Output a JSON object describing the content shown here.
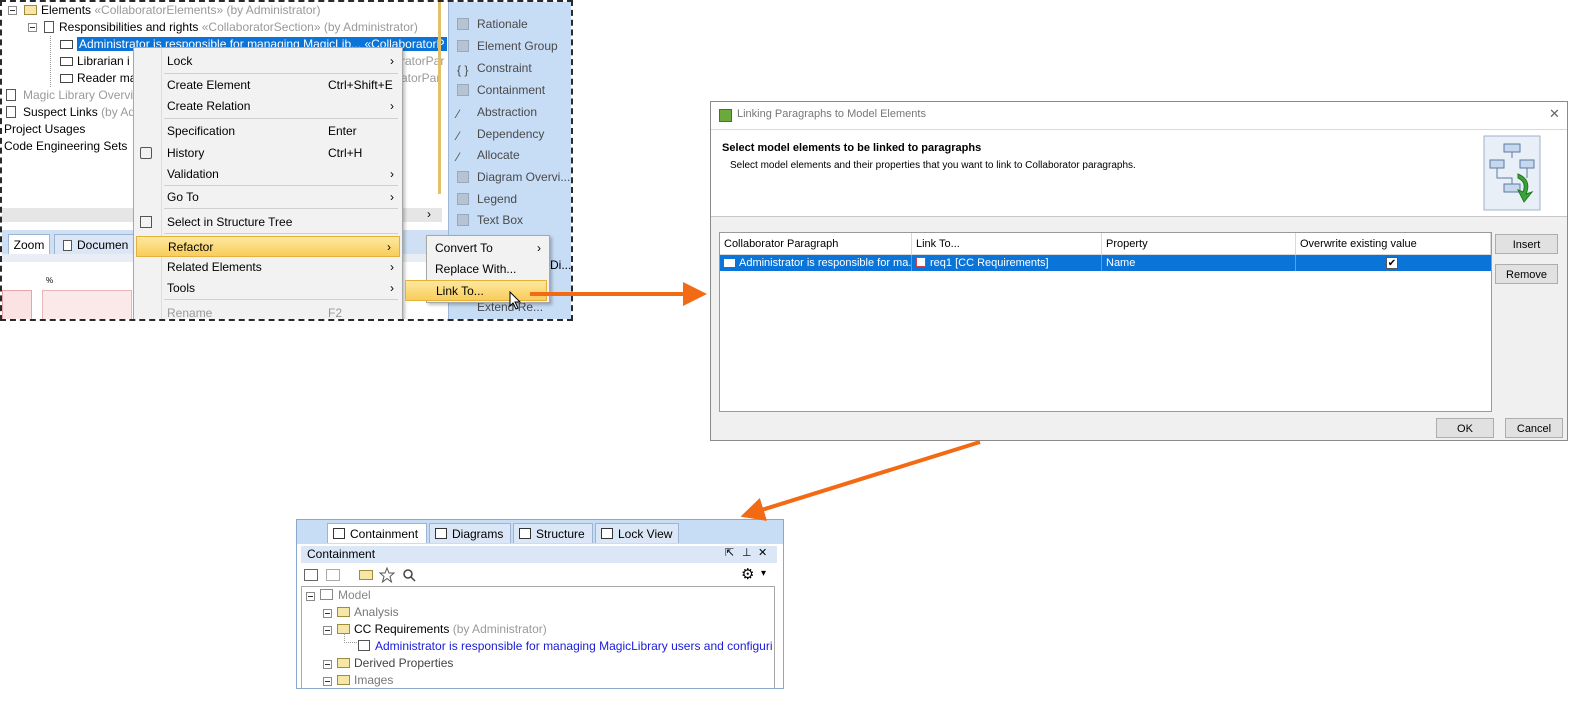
{
  "panel1": {
    "tree": {
      "row0": {
        "label": "Elements",
        "stereo": "«CollaboratorElements»",
        "owner": "(by Administrator)"
      },
      "row1": {
        "label": "Responsibilities and rights",
        "stereo": "«CollaboratorSection»",
        "owner": "(by Administrator)"
      },
      "row2": {
        "label": "Administrator is responsible for managing MagicLib... «CollaboratorP"
      },
      "row3": {
        "label": "Librarian i",
        "suffix": "ratorPar"
      },
      "row4": {
        "label": "Reader ma",
        "suffix": "atorPar"
      },
      "row5": {
        "label": "Magic Library Overvi"
      },
      "row6": {
        "label": "Suspect Links",
        "owner": "(by Adi"
      },
      "row7": {
        "label": "Project Usages"
      },
      "row8": {
        "label": "Code Engineering Sets"
      }
    },
    "tabs": {
      "zoom": "Zoom",
      "documentation": "Documen",
      "di": "Di..."
    },
    "ruler_mark": "%",
    "palette": [
      {
        "label": "Rationale"
      },
      {
        "label": "Element Group"
      },
      {
        "label": "Constraint"
      },
      {
        "label": "Containment"
      },
      {
        "label": "Abstraction"
      },
      {
        "label": "Dependency"
      },
      {
        "label": "Allocate"
      },
      {
        "label": "Diagram Overvi..."
      },
      {
        "label": "Legend"
      },
      {
        "label": "Text Box"
      },
      {
        "label": "Extend Re..."
      }
    ],
    "context_menu": {
      "lock": "Lock",
      "create_element": "Create Element",
      "create_element_sc": "Ctrl+Shift+E",
      "create_relation": "Create Relation",
      "specification": "Specification",
      "specification_sc": "Enter",
      "history": "History",
      "history_sc": "Ctrl+H",
      "validation": "Validation",
      "go_to": "Go To",
      "select_in_tree": "Select in Structure Tree",
      "refactor": "Refactor",
      "related_elements": "Related Elements",
      "tools": "Tools",
      "rename": "Rename",
      "rename_sc": "F2",
      "arrow": "›"
    },
    "submenu": {
      "convert_to": "Convert To",
      "replace_with": "Replace With...",
      "link_to": "Link To..."
    }
  },
  "dialog": {
    "title": "Linking Paragraphs to Model Elements",
    "header_title": "Select model elements to be linked to paragraphs",
    "header_desc": "Select model elements and their properties that you want to link to Collaborator paragraphs.",
    "columns": [
      "Collaborator Paragraph",
      "Link To...",
      "Property",
      "Overwrite existing value"
    ],
    "row": {
      "paragraph": "Administrator is responsible for ma...",
      "link_to": "req1 [CC Requirements]",
      "property": "Name",
      "overwrite": "✔"
    },
    "buttons": {
      "insert": "Insert",
      "remove": "Remove",
      "ok": "OK",
      "cancel": "Cancel"
    },
    "close": "✕"
  },
  "panel3": {
    "tabs": {
      "containment": "Containment",
      "diagrams": "Diagrams",
      "structure": "Structure",
      "lock_view": "Lock View"
    },
    "title": "Containment",
    "title_controls": {
      "popout": "⇱",
      "pin": "⊥",
      "close": "✕"
    },
    "toolbar_gear": "⚙",
    "toolbar_caret": "▾",
    "tree": {
      "model": "Model",
      "analysis": "Analysis",
      "cc_requirements": "CC Requirements",
      "cc_owner": "(by Administrator)",
      "requirement": "Administrator is responsible for managing MagicLibrary users and configuri",
      "derived": "Derived Properties",
      "images": "Images"
    }
  },
  "colors": {
    "arrow": "#f26b14",
    "selection": "#0a74d9",
    "palette_bg": "#c7dcf5",
    "menu_highlight": "#f8cd5a",
    "link_text": "#1a1adb"
  }
}
